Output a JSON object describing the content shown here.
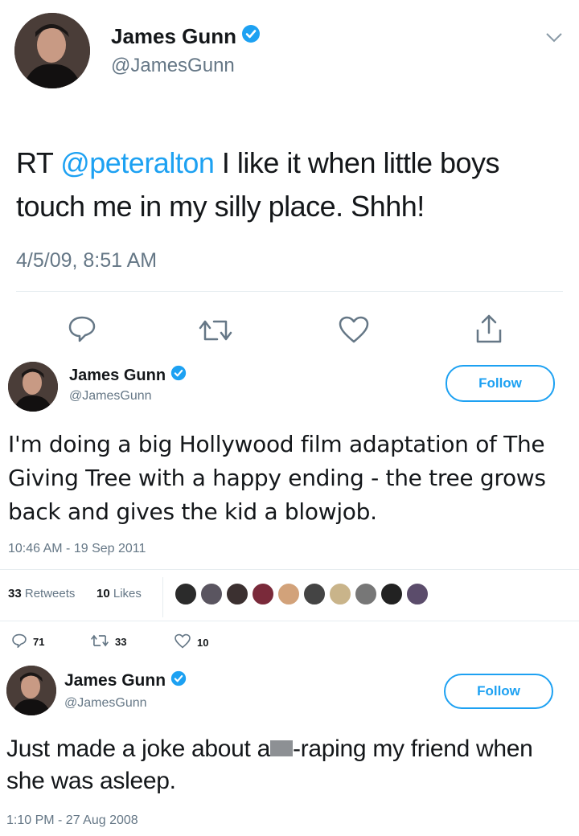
{
  "tweet1": {
    "name": "James Gunn",
    "handle": "@JamesGunn",
    "text_prefix": "RT ",
    "mention": "@peteralton",
    "text_rest": " I like it when little boys touch me in my silly place.  Shhh!",
    "timestamp": "4/5/09, 8:51 AM",
    "icons": [
      "reply-icon",
      "retweet-icon",
      "like-icon",
      "share-icon",
      "chevron-down-icon"
    ]
  },
  "tweet2": {
    "name": "James Gunn",
    "handle": "@JamesGunn",
    "follow_label": "Follow",
    "text": "I'm doing a big Hollywood film adaptation of The Giving Tree with a happy ending - the tree grows back and gives the kid a blowjob.",
    "timestamp": "10:46 AM - 19 Sep 2011",
    "retweets_count": "33",
    "retweets_label": "Retweets",
    "likes_count": "10",
    "likes_label": "Likes",
    "reply_count": "71",
    "retweet_count": "33",
    "like_count": "10",
    "liker_colors": [
      "#2b2b2b",
      "#5a5560",
      "#3b3030",
      "#7a2a3a",
      "#d2a27a",
      "#444444",
      "#c9b48a",
      "#777777",
      "#222222",
      "#5b4c6b"
    ]
  },
  "tweet3": {
    "name": "James Gunn",
    "handle": "@JamesGunn",
    "follow_label": "Follow",
    "text_before": "Just made a joke about a",
    "text_after": "-raping my friend when she was asleep.",
    "timestamp": "1:10 PM - 27 Aug 2008"
  },
  "colors": {
    "accent": "#1da1f2",
    "muted": "#657786",
    "text": "#14171a"
  }
}
